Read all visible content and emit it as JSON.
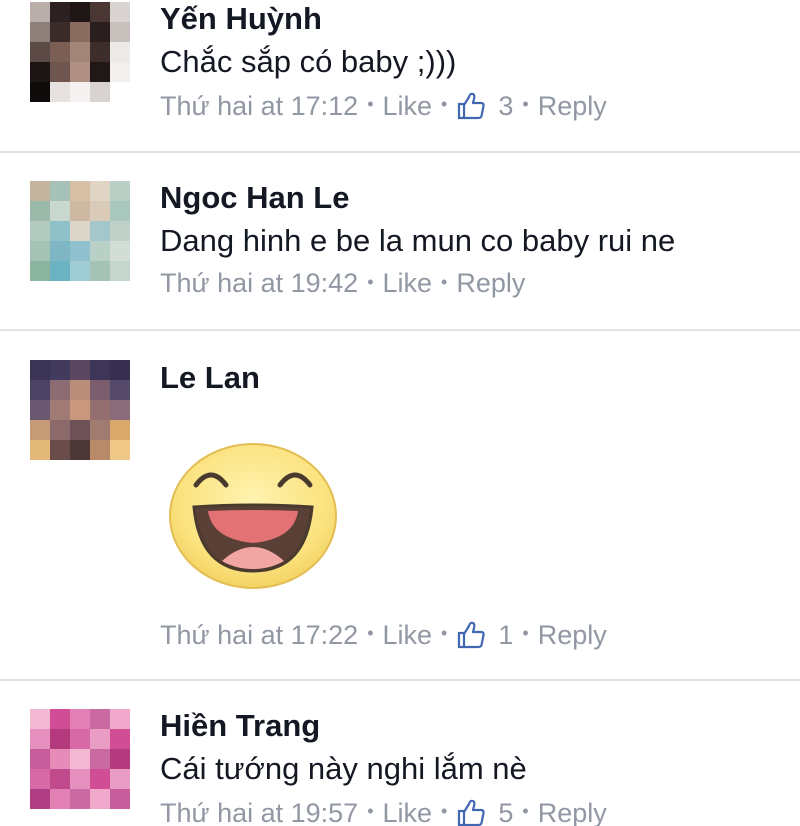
{
  "comments": [
    {
      "author": "Yến Huỳnh",
      "text": "Chắc sắp có baby ;)))",
      "time": "Thứ hai at 17:12",
      "like_label": "Like",
      "like_count": "3",
      "reply_label": "Reply",
      "avatar_colors": [
        "#c9c0bb",
        "#3a2b2a",
        "#7b5f55",
        "#e7e1df",
        "#1c1514"
      ]
    },
    {
      "author": "Ngoc Han Le",
      "text": "Dang hinh e be la mun co baby rui ne",
      "time": "Thứ hai at 19:42",
      "like_label": "Like",
      "reply_label": "Reply",
      "avatar_colors": [
        "#a9c8bd",
        "#cdb9a1",
        "#8fc1c9",
        "#9bb9a8",
        "#dcd6c9"
      ]
    },
    {
      "author": "Le Lan",
      "sticker": "laughing-face-sticker",
      "time": "Thứ hai at 17:22",
      "like_label": "Like",
      "like_count": "1",
      "reply_label": "Reply",
      "avatar_colors": [
        "#3a3456",
        "#8c6b73",
        "#d8a96a",
        "#5a4860",
        "#b88e78"
      ]
    },
    {
      "author": "Hiền Trang",
      "text": "Cái tướng này nghi lắm nè",
      "time": "Thứ hai at 19:57",
      "like_label": "Like",
      "like_count": "5",
      "reply_label": "Reply",
      "avatar_colors": [
        "#d14d95",
        "#e78cb9",
        "#b43a7e",
        "#f2b8d2",
        "#c96aa2"
      ]
    }
  ],
  "colors": {
    "name": "#141823",
    "meta": "#9197a3",
    "thumb": "#4267b2",
    "divider": "#e1e2e3"
  }
}
